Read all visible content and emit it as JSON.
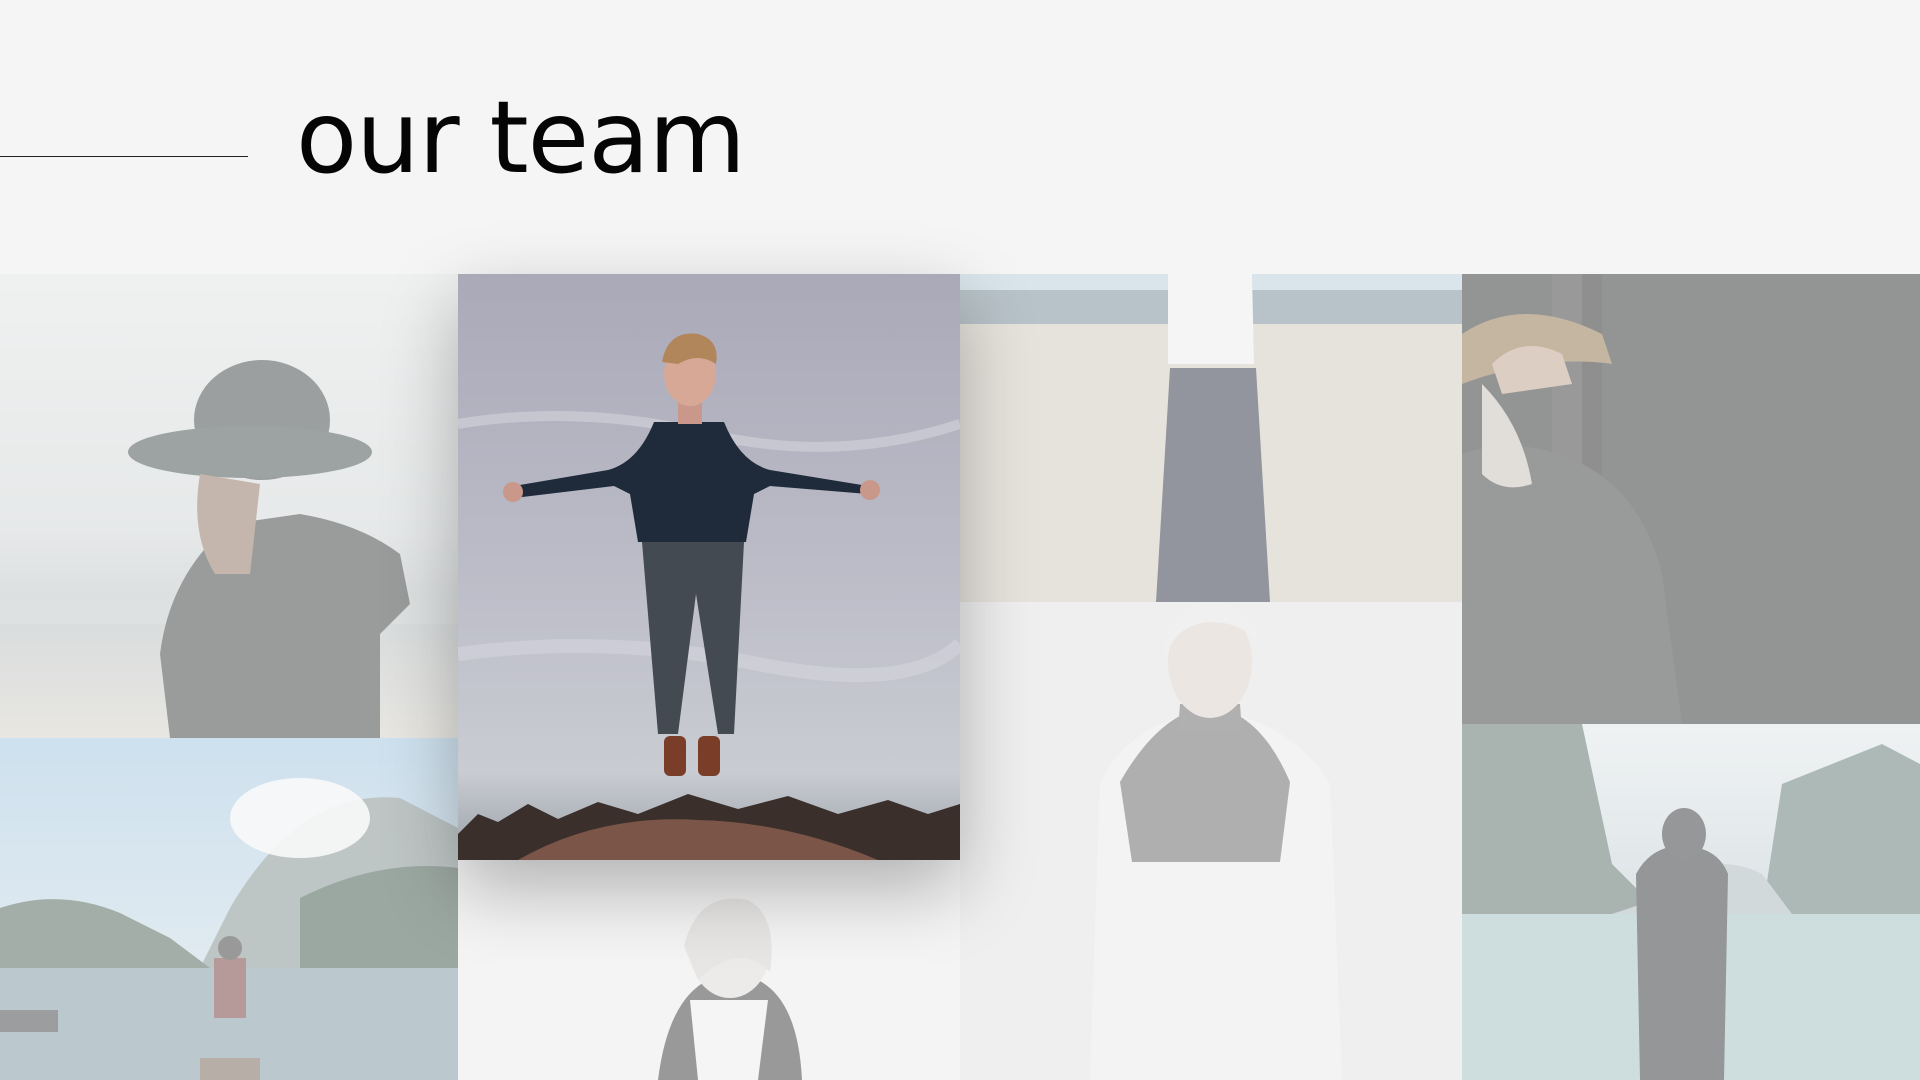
{
  "header": {
    "title": "our team"
  },
  "team_photos": [
    {
      "name": "woman-in-hat-portrait",
      "state": "faded"
    },
    {
      "name": "man-levitating-portrait",
      "state": "highlighted"
    },
    {
      "name": "person-on-beach-portrait",
      "state": "faded"
    },
    {
      "name": "bearded-man-in-hat-portrait",
      "state": "faded"
    },
    {
      "name": "person-on-dock-lake-portrait",
      "state": "faded"
    },
    {
      "name": "blonde-woman-white-coat-portrait",
      "state": "faded"
    },
    {
      "name": "person-by-mountain-lake-portrait",
      "state": "faded"
    },
    {
      "name": "blonde-woman-windswept-portrait",
      "state": "faded"
    }
  ],
  "colors": {
    "background": "#f5f5f5",
    "title": "#050505",
    "rule": "#222222"
  }
}
